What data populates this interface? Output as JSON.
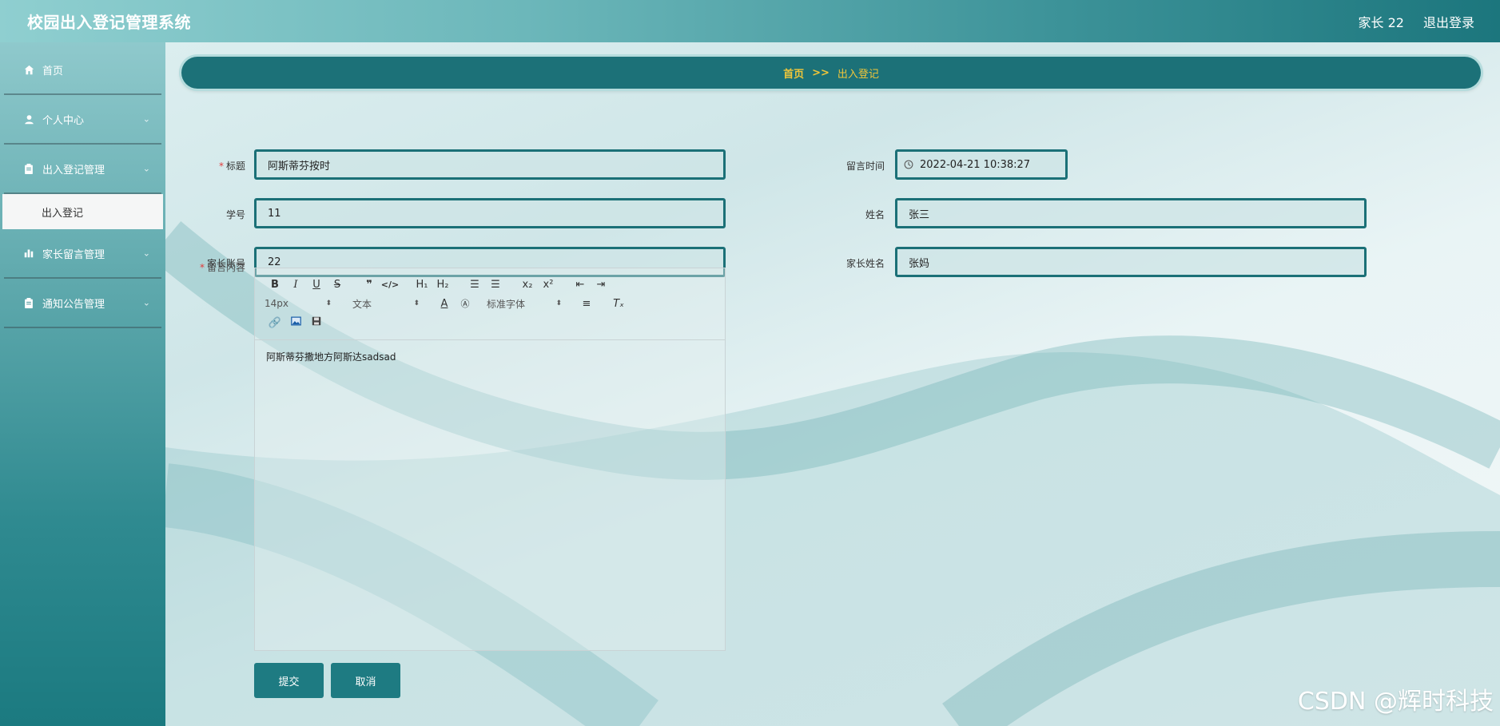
{
  "app": {
    "title": "校园出入登记管理系统"
  },
  "header": {
    "user_label": "家长 22",
    "logout_label": "退出登录"
  },
  "sidebar": {
    "items": [
      {
        "label": "首页",
        "icon": "home-icon"
      },
      {
        "label": "个人中心",
        "icon": "user-icon"
      },
      {
        "label": "出入登记管理",
        "icon": "clipboard-icon",
        "sub": [
          {
            "label": "出入登记"
          }
        ]
      },
      {
        "label": "家长留言管理",
        "icon": "bar-chart-icon"
      },
      {
        "label": "通知公告管理",
        "icon": "clipboard-icon"
      }
    ]
  },
  "breadcrumb": {
    "home": "首页",
    "separator": ">>",
    "current": "出入登记"
  },
  "form": {
    "title_label": "标题",
    "title_value": "阿斯蒂芬按时",
    "time_label": "留言时间",
    "time_value": "2022-04-21 10:38:27",
    "student_no_label": "学号",
    "student_no_value": "11",
    "name_label": "姓名",
    "name_value": "张三",
    "parent_account_label": "家长账号",
    "parent_account_value": "22",
    "parent_name_label": "家长姓名",
    "parent_name_value": "张妈",
    "content_label": "留言内容",
    "content_value": "阿斯蒂芬撒地方阿斯达sadsad"
  },
  "editor_toolbar": {
    "font_size": "14px",
    "block_type": "文本",
    "font_family": "标准字体"
  },
  "buttons": {
    "submit": "提交",
    "cancel": "取消"
  },
  "watermark": "CSDN @辉时科技",
  "colors": {
    "primary": "#1e7b82",
    "accent": "#f0c63a"
  }
}
